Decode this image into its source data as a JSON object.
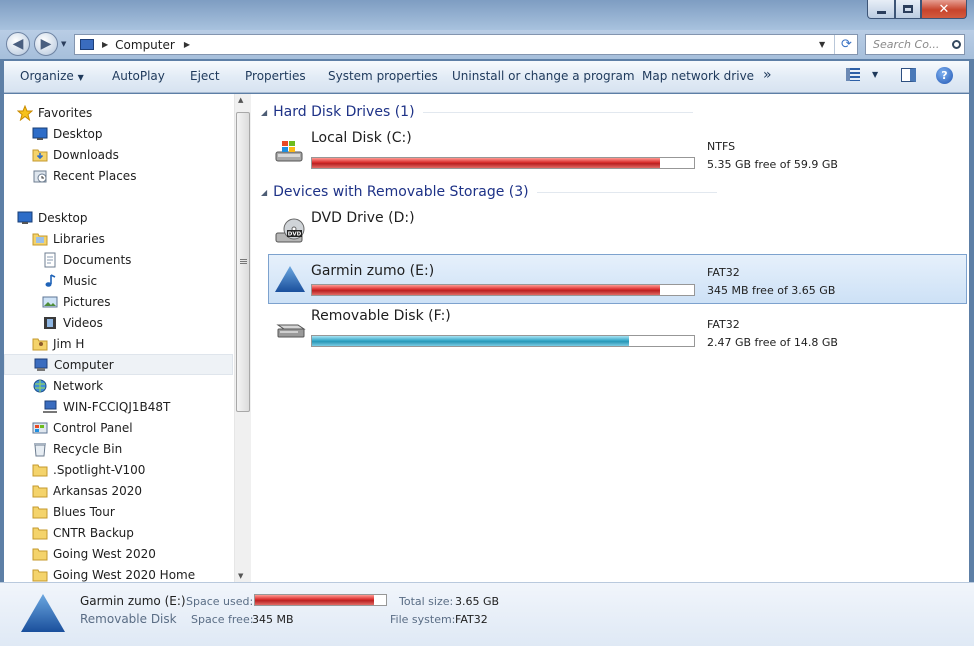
{
  "window": {
    "min_label": "",
    "max_label": "",
    "close_label": "✕"
  },
  "address_bar": {
    "segments": [
      "Computer"
    ],
    "search_placeholder": "Search Co..."
  },
  "toolbar": {
    "organize": "Organize",
    "autoplay": "AutoPlay",
    "eject": "Eject",
    "properties": "Properties",
    "system_properties": "System properties",
    "uninstall": "Uninstall or change a program",
    "map_drive": "Map network drive",
    "more": "»"
  },
  "nav_tree": [
    {
      "label": "Favorites",
      "icon": "star-icon",
      "indent": 0
    },
    {
      "label": "Desktop",
      "icon": "desktop-icon",
      "indent": 1
    },
    {
      "label": "Downloads",
      "icon": "downloads-folder-icon",
      "indent": 1
    },
    {
      "label": "Recent Places",
      "icon": "recent-places-icon",
      "indent": 1
    },
    {
      "label": "",
      "icon": "",
      "indent": 0
    },
    {
      "label": "Desktop",
      "icon": "desktop-icon",
      "indent": 0
    },
    {
      "label": "Libraries",
      "icon": "libraries-icon",
      "indent": 1
    },
    {
      "label": "Documents",
      "icon": "documents-icon",
      "indent": 2
    },
    {
      "label": "Music",
      "icon": "music-icon",
      "indent": 2
    },
    {
      "label": "Pictures",
      "icon": "pictures-icon",
      "indent": 2
    },
    {
      "label": "Videos",
      "icon": "videos-icon",
      "indent": 2
    },
    {
      "label": "Jim H",
      "icon": "user-folder-icon",
      "indent": 1
    },
    {
      "label": "Computer",
      "icon": "computer-icon",
      "indent": 1,
      "selected": true
    },
    {
      "label": "Network",
      "icon": "network-icon",
      "indent": 1
    },
    {
      "label": "WIN-FCCIQJ1B48T",
      "icon": "network-computer-icon",
      "indent": 2
    },
    {
      "label": "Control Panel",
      "icon": "control-panel-icon",
      "indent": 1
    },
    {
      "label": "Recycle Bin",
      "icon": "recycle-bin-icon",
      "indent": 1
    },
    {
      "label": ".Spotlight-V100",
      "icon": "folder-icon",
      "indent": 1
    },
    {
      "label": "Arkansas 2020",
      "icon": "folder-icon",
      "indent": 1
    },
    {
      "label": "Blues Tour",
      "icon": "folder-icon",
      "indent": 1
    },
    {
      "label": "CNTR Backup",
      "icon": "folder-icon",
      "indent": 1
    },
    {
      "label": "Going West 2020",
      "icon": "folder-icon",
      "indent": 1
    },
    {
      "label": "Going West 2020 Home",
      "icon": "folder-icon",
      "indent": 1
    }
  ],
  "groups": [
    {
      "title": "Hard Disk Drives (1)"
    },
    {
      "title": "Devices with Removable Storage (3)"
    }
  ],
  "drives": [
    {
      "name": "Local Disk (C:)",
      "fs": "NTFS",
      "free": "5.35 GB free of 59.9 GB",
      "used_fraction": 0.91,
      "color": "red",
      "icon": "windows-drive-icon",
      "selected": false
    },
    {
      "name": "DVD Drive (D:)",
      "fs": "",
      "free": "",
      "used_fraction": null,
      "color": "",
      "icon": "dvd-drive-icon",
      "selected": false
    },
    {
      "name": "Garmin zumo (E:)",
      "fs": "FAT32",
      "free": "345 MB free of 3.65 GB",
      "used_fraction": 0.91,
      "color": "red",
      "icon": "garmin-triangle-icon",
      "selected": true
    },
    {
      "name": "Removable Disk (F:)",
      "fs": "FAT32",
      "free": "2.47 GB free of 14.8 GB",
      "used_fraction": 0.83,
      "color": "blue",
      "icon": "removable-disk-icon",
      "selected": false
    }
  ],
  "details": {
    "name": "Garmin zumo (E:)",
    "type": "Removable Disk",
    "space_used_label": "Space used:",
    "space_used_fraction": 0.91,
    "space_free_label": "Space free:",
    "space_free": "345 MB",
    "total_size_label": "Total size:",
    "total_size": "3.65 GB",
    "file_system_label": "File system:",
    "file_system": "FAT32"
  },
  "colors": {
    "accent": "#1e3287",
    "bar_red": "#d92c2c",
    "bar_blue": "#2896b6",
    "selection": "#cde1f6"
  }
}
